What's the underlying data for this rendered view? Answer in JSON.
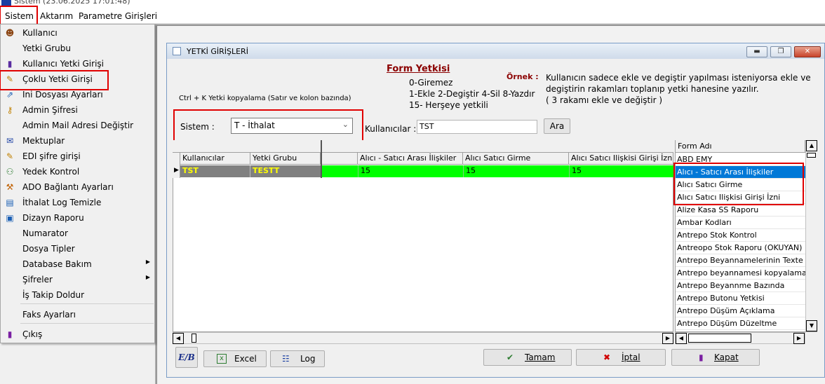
{
  "app": {
    "title": "Sistem (23.06.2025 17:01:48)"
  },
  "menubar": {
    "items": [
      "Sistem",
      "Aktarım",
      "Parametre Girişleri"
    ]
  },
  "menu": {
    "items": [
      {
        "label": "Kullanıcı",
        "icon": "user-icon"
      },
      {
        "label": "Yetki Grubu",
        "icon": ""
      },
      {
        "label": "Kullanıcı Yetki Girişi",
        "icon": "book-icon"
      },
      {
        "label": "Çoklu Yetki Girişi",
        "icon": "tools-icon"
      },
      {
        "label": "Ini Dosyası  Ayarları",
        "icon": "export-icon"
      },
      {
        "label": "Admin Şifresi",
        "icon": "key-icon"
      },
      {
        "label": "Admin Mail Adresi Değiştir",
        "icon": ""
      },
      {
        "label": "Mektuplar",
        "icon": "letter-icon"
      },
      {
        "label": "EDI şifre girişi",
        "icon": "tools-icon"
      },
      {
        "label": "Yedek Kontrol",
        "icon": "network-icon"
      },
      {
        "label": "ADO Bağlantı Ayarları",
        "icon": "wrench-icon"
      },
      {
        "label": "İthalat Log Temizle",
        "icon": "log-icon"
      },
      {
        "label": "Dizayn Raporu",
        "icon": "report-icon"
      },
      {
        "label": "Numarator",
        "icon": ""
      },
      {
        "label": "Dosya Tipler",
        "icon": ""
      },
      {
        "label": "Database Bakım",
        "icon": ""
      },
      {
        "label": "Şifreler",
        "icon": ""
      },
      {
        "label": "İş Takip Doldur",
        "icon": ""
      },
      {
        "label": "Faks Ayarları",
        "icon": ""
      },
      {
        "label": "Çıkış",
        "icon": "exit-icon"
      }
    ]
  },
  "window": {
    "title": "YETKİ GİRİŞLERİ"
  },
  "info": {
    "form_title": "Form Yetkisi",
    "line1": "0-Giremez",
    "line2": "1-Ekle  2-Degiştir  4-Sil  8-Yazdır",
    "line3": "15- Herşeye yetkili",
    "example_label": "Örnek :",
    "example_text1": "Kullanıcın sadece ekle ve degiştir yapılması isteniyorsa  ekle ve",
    "example_text2": "degiştirin rakamları toplanıp yetki hanesine yazılır.",
    "example_text3": " ( 3 rakamı ekle ve değiştir )",
    "ctrl_hint": "Ctrl + K Yetki kopyalama (Satır ve kolon bazında)"
  },
  "filter": {
    "system_label": "Sistem :",
    "system_value": "T - İthalat",
    "user_label": "Kullanıcılar :",
    "user_value": "TST",
    "search_button": "Ara"
  },
  "grid": {
    "fixed_headers": [
      "Kullanıcılar",
      "Yetki Grubu"
    ],
    "headers": [
      "Alıcı - Satıcı Arası İlişkiler",
      "Alıcı Satıcı Girme",
      "Alıcı Satıcı Ilişkisi Girişi İzni"
    ],
    "row": {
      "user": "TST",
      "group": "TESTT",
      "values": [
        "15",
        "15",
        "15"
      ]
    }
  },
  "formlist": {
    "header": "Form Adı",
    "items": [
      "ABD EMY",
      "Alıcı - Satıcı Arası İlişkiler",
      "Alıcı Satıcı Girme",
      "Alıcı Satıcı Ilişkisi Girişi İzni",
      "Alize Kasa SS Raporu",
      "Ambar Kodları",
      "Antrepo Stok Kontrol",
      "Antreopo Stok Raporu (OKUYAN)",
      "Antrepo Beyannamelerinin Texte Aktarı",
      "Antrepo beyannamesi kopyalama yetkis",
      "Antrepo Beyannme Bazında",
      "Antrepo Butonu Yetkisi",
      "Antrepo Düşüm Açıklama",
      "Antrepo Düşüm Düzeltme"
    ]
  },
  "buttons": {
    "logo": "E/B",
    "excel": "Excel",
    "log": "Log",
    "ok": "Tamam",
    "cancel": "İptal",
    "close": "Kapat"
  },
  "colors": {
    "highlight": "#e00000",
    "grid_green": "#00ff00",
    "row_gray": "#808080",
    "row_text_yellow": "#ffff00",
    "list_selected": "#0078d7"
  }
}
